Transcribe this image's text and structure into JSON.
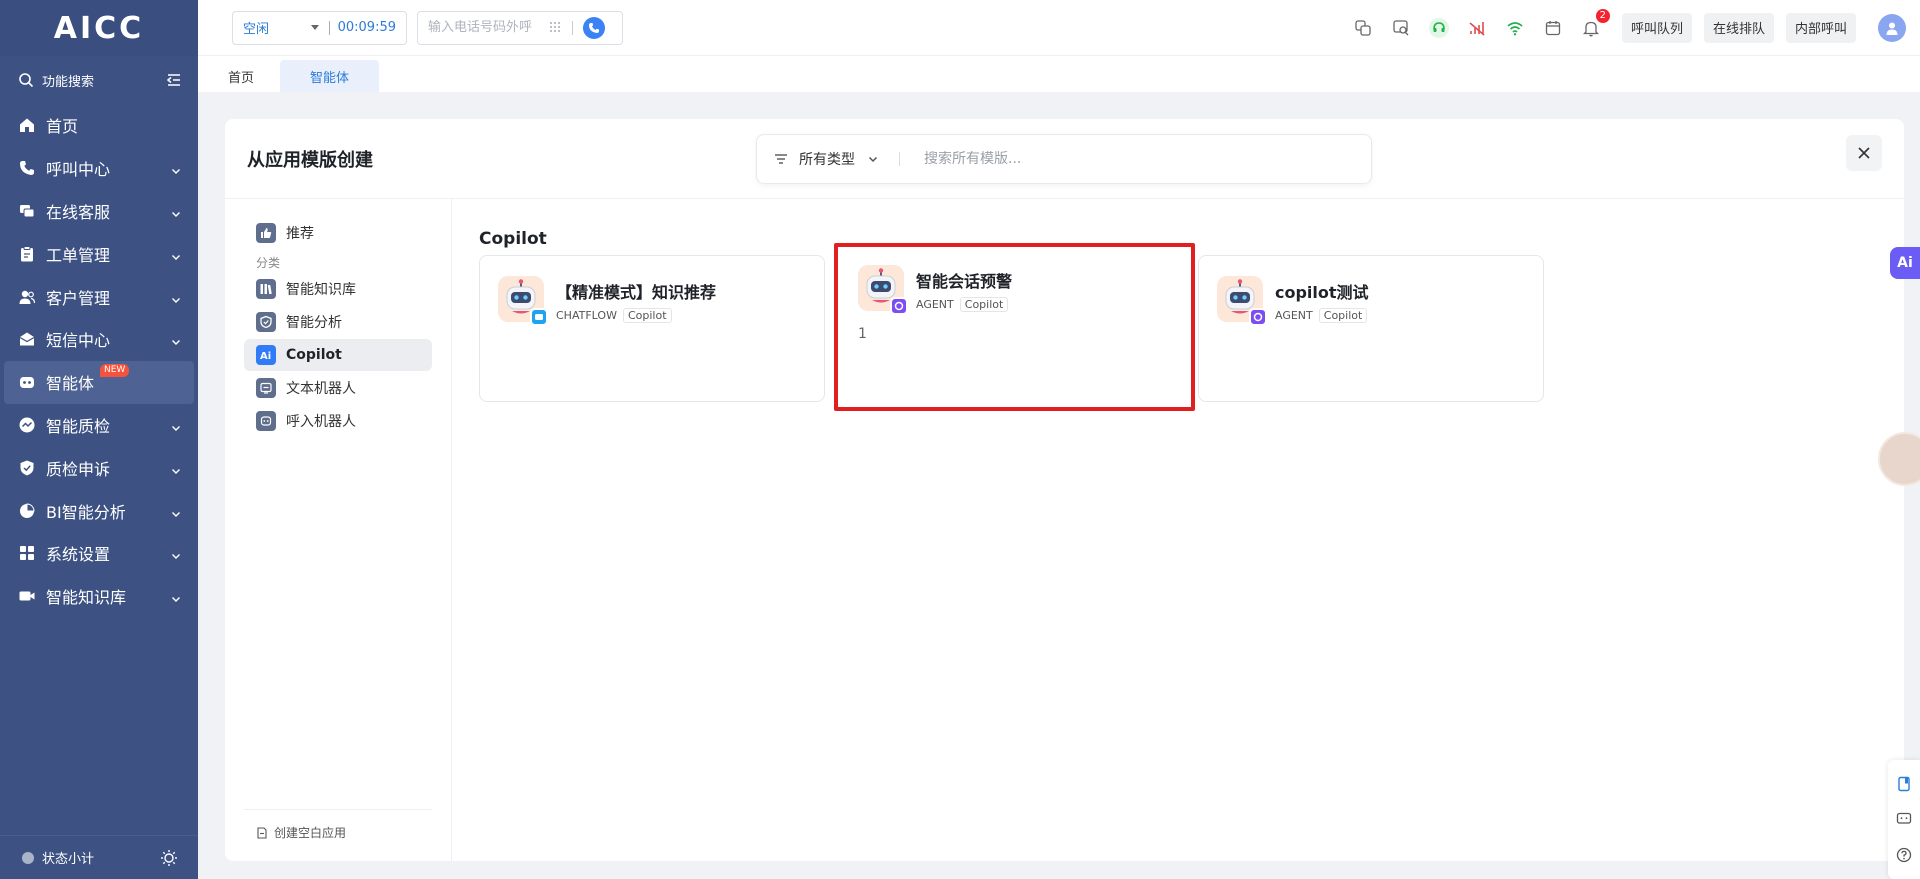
{
  "app": {
    "logo": "AICC"
  },
  "sidebar": {
    "search_label": "功能搜索",
    "items": [
      {
        "label": "首页",
        "icon": "home-icon",
        "has_children": false
      },
      {
        "label": "呼叫中心",
        "icon": "phone-icon",
        "has_children": true
      },
      {
        "label": "在线客服",
        "icon": "chat-icon",
        "has_children": true
      },
      {
        "label": "工单管理",
        "icon": "clipboard-icon",
        "has_children": true
      },
      {
        "label": "客户管理",
        "icon": "users-icon",
        "has_children": true
      },
      {
        "label": "短信中心",
        "icon": "mail-icon",
        "has_children": true
      },
      {
        "label": "智能体",
        "icon": "robot-icon",
        "has_children": false,
        "active": true,
        "badge": "NEW"
      },
      {
        "label": "智能质检",
        "icon": "chart-icon",
        "has_children": true
      },
      {
        "label": "质检申诉",
        "icon": "shield-icon",
        "has_children": true
      },
      {
        "label": "BI智能分析",
        "icon": "pie-icon",
        "has_children": true
      },
      {
        "label": "系统设置",
        "icon": "grid-icon",
        "has_children": true
      },
      {
        "label": "智能知识库",
        "icon": "video-icon",
        "has_children": true
      }
    ],
    "footer_label": "状态小计"
  },
  "topbar": {
    "status": "空闲",
    "timer": "00:09:59",
    "phone_placeholder": "输入电话号码外呼",
    "notification_count": "2",
    "buttons": [
      "呼叫队列",
      "在线排队",
      "内部呼叫"
    ]
  },
  "tabs": [
    {
      "label": "首页",
      "active": false
    },
    {
      "label": "智能体",
      "active": true
    }
  ],
  "modal": {
    "title": "从应用模版创建",
    "filter_label": "所有类型",
    "search_placeholder": "搜索所有模版...",
    "categories": {
      "recommend": "推荐",
      "group_label": "分类",
      "items": [
        "智能知识库",
        "智能分析",
        "Copilot",
        "文本机器人",
        "呼入机器人"
      ],
      "active": "Copilot"
    },
    "blank_app_label": "创建空白应用",
    "section_title": "Copilot",
    "cards": [
      {
        "name": "【精准模式】知识推荐",
        "type": "CHATFLOW",
        "tag": "Copilot",
        "desc": "",
        "badge_color": "#1fa3f0",
        "highlight": false
      },
      {
        "name": "智能会话预警",
        "type": "AGENT",
        "tag": "Copilot",
        "desc": "1",
        "badge_color": "#7b4df2",
        "highlight": true
      },
      {
        "name": "copilot测试",
        "type": "AGENT",
        "tag": "Copilot",
        "desc": "",
        "badge_color": "#7b4df2",
        "highlight": false
      }
    ]
  },
  "floating": {
    "ai_label": "Ai"
  },
  "colors": {
    "sidebar": "#3d5283",
    "accent": "#2b7bd9",
    "highlight": "#e02020"
  }
}
